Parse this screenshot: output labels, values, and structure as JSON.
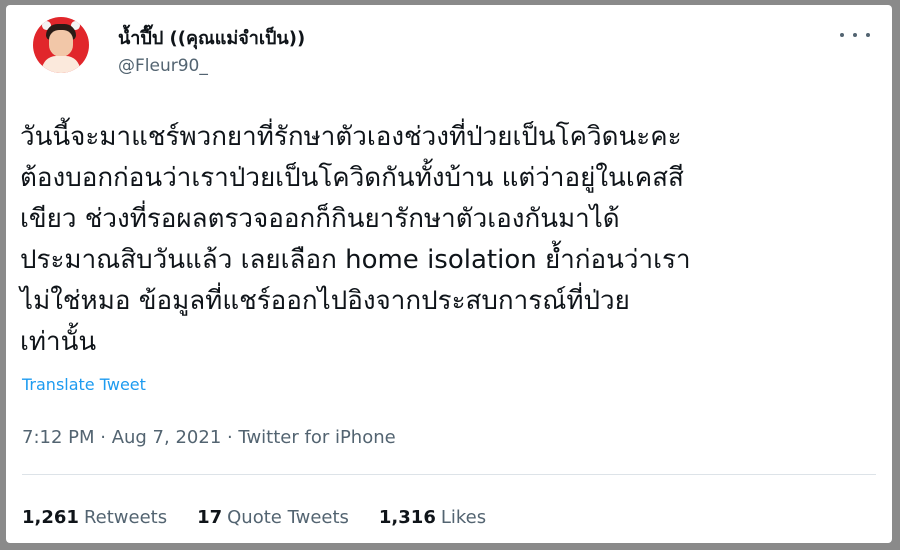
{
  "user": {
    "display_name": "น้ำปี๊ป ((คุณแม่จำเป็น))",
    "handle": "@Fleur90_"
  },
  "tweet": {
    "text_lines": [
      "วันนี้จะมาแชร์พวกยาที่รักษาตัวเองช่วงที่ป่วยเป็นโควิดนะคะ",
      "ต้องบอกก่อนว่าเราป่วยเป็นโควิดกันทั้งบ้าน แต่ว่าอยู่ในเคสสี",
      "เขียว ช่วงที่รอผลตรวจออกก็กินยารักษาตัวเองกันมาได้",
      "ประมาณสิบวันแล้ว เลยเลือก home isolation ย้ำก่อนว่าเรา",
      "ไม่ใช่หมอ ข้อมูลที่แชร์ออกไปอิงจากประสบการณ์ที่ป่วย",
      "เท่านั้น"
    ],
    "translate_label": "Translate Tweet",
    "timestamp": "7:12 PM · Aug 7, 2021 · Twitter for iPhone"
  },
  "stats": {
    "retweets_count": "1,261",
    "retweets_label": "Retweets",
    "quotes_count": "17",
    "quotes_label": "Quote Tweets",
    "likes_count": "1,316",
    "likes_label": "Likes"
  },
  "colors": {
    "link": "#1d9bf0",
    "secondary_text": "#536471",
    "avatar_bg": "#e1262b"
  },
  "icons": [
    "more-options-icon"
  ]
}
